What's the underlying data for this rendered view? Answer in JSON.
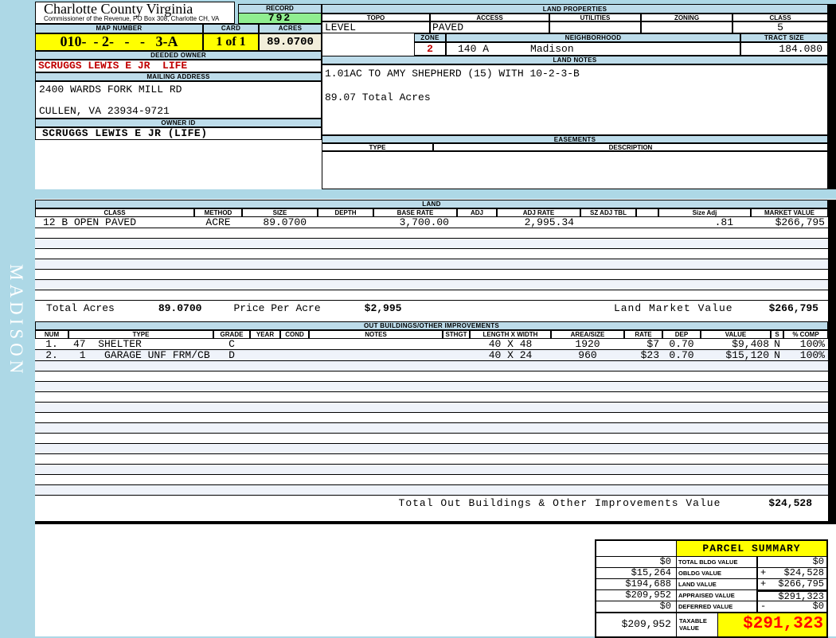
{
  "sidebar": {
    "vertical_text": "MADISON"
  },
  "header": {
    "title": "Charlotte County Virginia",
    "subtitle": "Commissioner of the Revenue, PO Box 308, Charlotte CH, VA",
    "record_label": "RECORD",
    "record_value": "792",
    "map_number_label": "MAP NUMBER",
    "map_number_value": "010-  - 2-   -   -   3-A",
    "card_label": "CARD",
    "card_value": "1 of 1",
    "acres_label": "ACRES",
    "acres_value": "89.0700"
  },
  "owner": {
    "deeded_owner_label": "DEEDED OWNER",
    "deeded_owner": "SCRUGGS LEWIS E JR  LIFE",
    "mailing_address_label": "MAILING ADDRESS",
    "address_line1": "2400 WARDS FORK MILL RD",
    "address_line2": "CULLEN, VA 23934-9721",
    "owner_id_label": "OWNER ID",
    "owner_id": "SCRUGGS LEWIS E JR (LIFE)"
  },
  "land_properties": {
    "title": "LAND PROPERTIES",
    "topo_label": "TOPO",
    "access_label": "ACCESS",
    "utilities_label": "UTILITIES",
    "zoning_label": "ZONING",
    "class_label": "CLASS",
    "topo": "LEVEL",
    "access": "PAVED",
    "utilities": "",
    "zoning": "",
    "class": "5",
    "zone_label": "ZONE",
    "zone": "2",
    "neighborhood_label": "NEIGHBORHOOD",
    "neighborhood_code": "140 A",
    "neighborhood_name": "Madison",
    "tract_size_label": "TRACT SIZE",
    "tract_size": "184.080"
  },
  "land_notes": {
    "title": "LAND NOTES",
    "line1": "1.01AC TO AMY SHEPHERD (15) WITH 10-2-3-B",
    "line2": "89.07 Total Acres"
  },
  "easements": {
    "title": "EASEMENTS",
    "type_label": "TYPE",
    "description_label": "DESCRIPTION"
  },
  "land": {
    "title": "LAND",
    "headers": [
      "CLASS",
      "METHOD",
      "SIZE",
      "DEPTH",
      "BASE RATE",
      "ADJ",
      "ADJ RATE",
      "SZ ADJ TBL",
      "",
      "Size Adj",
      "MARKET VALUE"
    ],
    "row": {
      "class": "12 B OPEN PAVED",
      "method": "ACRE",
      "size": "89.0700",
      "depth": "",
      "base_rate": "3,700.00",
      "adj": "",
      "adj_rate": "2,995.34",
      "sz_adj_tbl": "",
      "size_adj": ".81",
      "market_value": "$266,795"
    },
    "total_acres_label": "Total Acres",
    "total_acres": "89.0700",
    "price_per_acre_label": "Price Per Acre",
    "price_per_acre": "$2,995",
    "land_market_value_label": "Land Market Value",
    "land_market_value": "$266,795"
  },
  "outbuildings": {
    "title": "OUT BUILDINGS/OTHER IMPROVEMENTS",
    "headers": [
      "NUM",
      "TYPE",
      "GRADE",
      "YEAR",
      "COND",
      "NOTES",
      "STHGT",
      "LENGTH X WIDTH",
      "AREA/SIZE",
      "RATE",
      "DEP",
      "VALUE",
      "S",
      "% COMP"
    ],
    "rows": [
      {
        "num": "1.",
        "type": "47  SHELTER",
        "grade": "C",
        "year": "",
        "cond": "",
        "notes": "",
        "sthgt": "",
        "length_width": "40 X 48",
        "area_size": "1920",
        "rate": "$7",
        "dep": "0.70",
        "value": "$9,408",
        "s": "N",
        "pct_comp": "100%"
      },
      {
        "num": "2.",
        "type": " 1   GARAGE UNF FRM/CB",
        "grade": "D",
        "year": "",
        "cond": "",
        "notes": "",
        "sthgt": "",
        "length_width": "40 X 24",
        "area_size": "960",
        "rate": "$23",
        "dep": "0.70",
        "value": "$15,120",
        "s": "N",
        "pct_comp": "100%"
      }
    ],
    "total_label": "Total Out Buildings & Other Improvements Value",
    "total_value": "$24,528"
  },
  "parcel_summary": {
    "title": "PARCEL SUMMARY",
    "rows": [
      {
        "prior": "$0",
        "label": "TOTAL BLDG VALUE",
        "op": "",
        "value": "$0"
      },
      {
        "prior": "$15,264",
        "label": "OBLDG VALUE",
        "op": "+",
        "value": "$24,528"
      },
      {
        "prior": "$194,688",
        "label": "LAND VALUE",
        "op": "+",
        "value": "$266,795"
      },
      {
        "prior": "$209,952",
        "label": "APPRAISED VALUE",
        "op": "",
        "value": "$291,323"
      },
      {
        "prior": "$0",
        "label": "DEFERRED VALUE",
        "op": "-",
        "value": "$0"
      }
    ],
    "taxable_prior": "$209,952",
    "taxable_label": "TAXABLE VALUE",
    "taxable_value": "$291,323"
  },
  "colors": {
    "page_background": "#ADD8E6",
    "section_header_blue": "#BDDCEA",
    "record_green": "#90EE90",
    "highlight_yellow": "#FFFF00",
    "acres_cream": "#F2EEDA",
    "owner_red": "#C00000",
    "taxable_red": "#FF0000",
    "stripe_blue": "#EFF3FA"
  }
}
